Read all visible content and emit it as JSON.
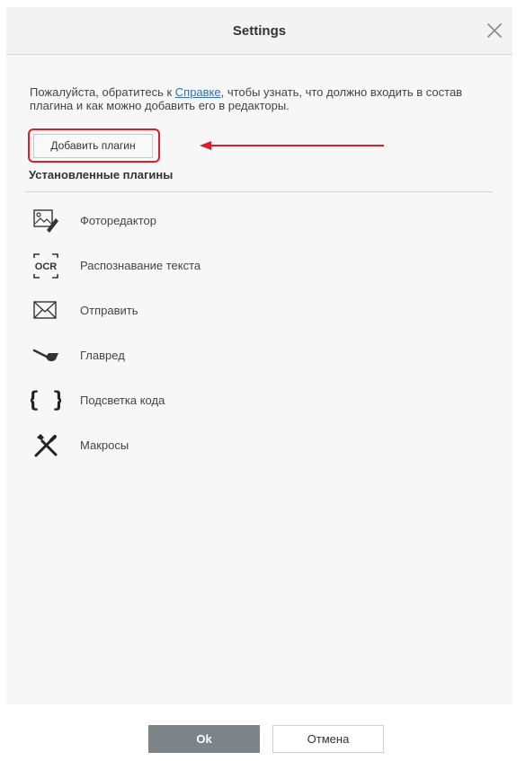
{
  "window": {
    "title": "Settings"
  },
  "content": {
    "help_text_before": "Пожалуйста, обратитесь к ",
    "help_link": "Справке",
    "help_text_after": ", чтобы узнать, что должно входить в состав плагина и как можно добавить его в редакторы.",
    "add_plugin_button": "Добавить плагин",
    "installed_title": "Установленные плагины",
    "plugins": [
      {
        "label": "Фоторедактор",
        "icon": "photo-editor-icon"
      },
      {
        "label": "Распознавание текста",
        "icon": "ocr-icon"
      },
      {
        "label": "Отправить",
        "icon": "mail-icon"
      },
      {
        "label": "Главред",
        "icon": "pipe-icon"
      },
      {
        "label": "Подсветка кода",
        "icon": "code-braces-icon"
      },
      {
        "label": "Макросы",
        "icon": "tools-icon"
      }
    ]
  },
  "footer": {
    "ok_button": "Ok",
    "cancel_button": "Отмена"
  },
  "colors": {
    "accent_red": "#d81f2b",
    "link_blue": "#2f6fb8",
    "ok_button_bg": "#7c8389"
  }
}
